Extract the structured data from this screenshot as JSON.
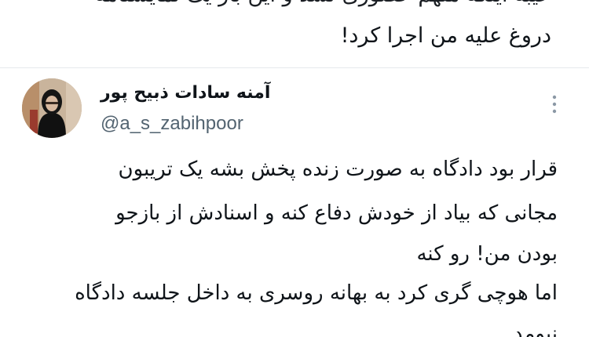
{
  "top_tweet": {
    "line_1": "عیبه اینکه متهم حضوری نشد و این بار یک نمایشنامه",
    "line_2": "دروغ علیه من اجرا کرد!"
  },
  "quoted_tweet": {
    "display_name": "آمنه سادات ذبیح پور",
    "handle": "@a_s_zabihpoor",
    "more_icon": "more-vertical-icon",
    "lines": [
      "قرار بود دادگاه به صورت زنده پخش بشه یک تریبون",
      "مجانی که بیاد از خودش دفاع کنه و اسنادش از بازجو",
      "بودن من! رو کنه",
      "اما هوچی گری کرد به بهانه روسری به داخل جلسه دادگاه",
      "نیومد"
    ]
  },
  "colors": {
    "text": "#0f1419",
    "secondary": "#536471",
    "divider": "#e6e9ec"
  }
}
